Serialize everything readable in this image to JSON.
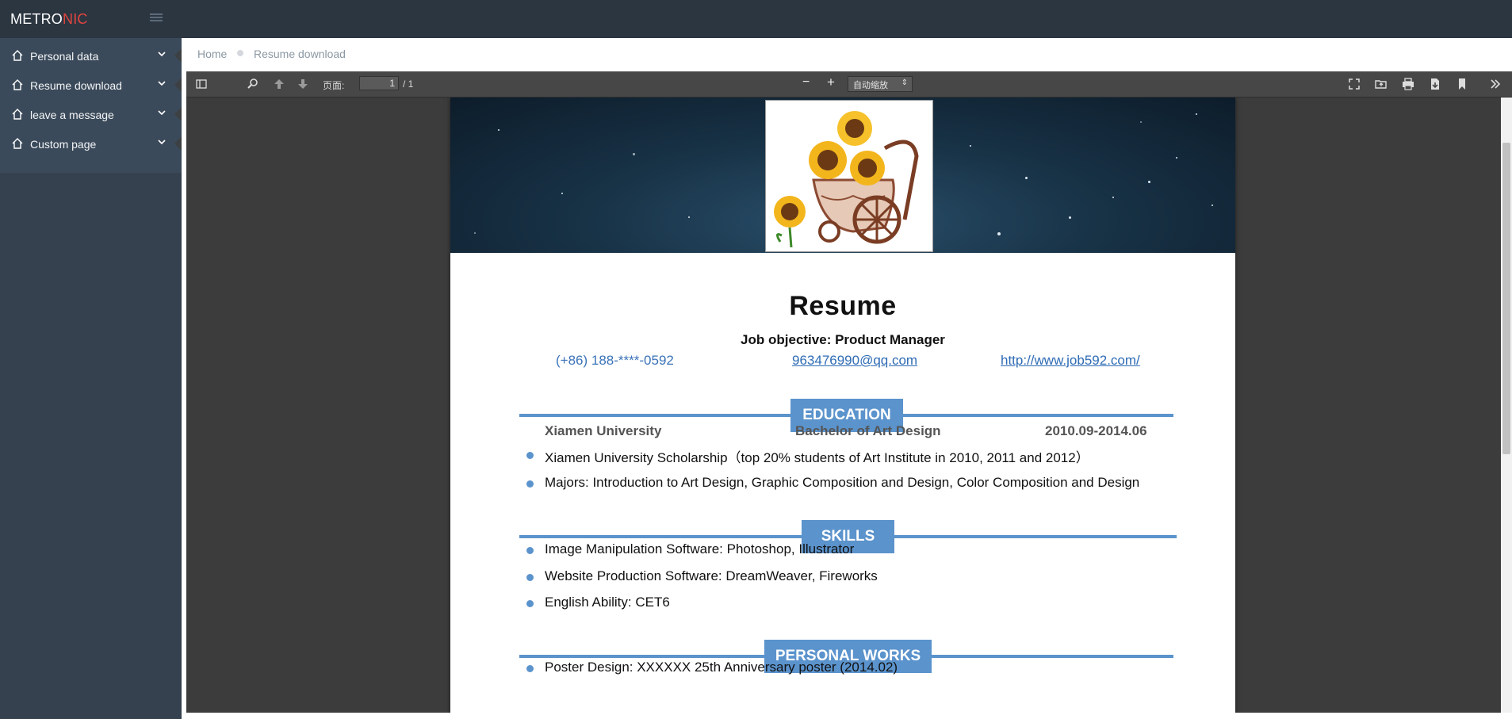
{
  "app": {
    "logo_prefix": "METRO",
    "logo_accent": "NIC",
    "accent_color": "#e3453f",
    "sidebar_bg": "#364150"
  },
  "sidebar": {
    "items": [
      {
        "label": "Personal data",
        "icon": "home-icon"
      },
      {
        "label": "Resume download",
        "icon": "home-icon"
      },
      {
        "label": "leave a message",
        "icon": "home-icon"
      },
      {
        "label": "Custom page",
        "icon": "home-icon"
      }
    ]
  },
  "breadcrumb": {
    "home": "Home",
    "current": "Resume download"
  },
  "pdf_toolbar": {
    "page_label": "页面:",
    "page_current": "1",
    "page_total": "/ 1",
    "zoom_value": "自动缩放",
    "minus": "−",
    "plus": "+"
  },
  "resume": {
    "title": "Resume",
    "objective": "Job objective: Product Manager",
    "phone": "(+86) 188-****-0592",
    "email": "963476990@qq.com",
    "website": "http://www.job592.com/",
    "section_color": "#5b93cc",
    "education": {
      "heading": "EDUCATION",
      "school": "Xiamen University",
      "degree": "Bachelor of Art Design",
      "period": "2010.09-2014.06",
      "bullets": [
        "Xiamen University Scholarship（top 20% students of Art Institute in 2010, 2011 and 2012）",
        "Majors: Introduction to Art Design, Graphic Composition and Design, Color Composition and Design"
      ]
    },
    "skills": {
      "heading": "SKILLS",
      "bullets": [
        "Image Manipulation Software: Photoshop, Illustrator",
        "Website Production Software: DreamWeaver, Fireworks",
        "English Ability: CET6"
      ]
    },
    "works": {
      "heading": "PERSONAL WORKS",
      "bullets": [
        "Poster Design: XXXXXX  25th Anniversary poster (2014.02)"
      ]
    }
  }
}
